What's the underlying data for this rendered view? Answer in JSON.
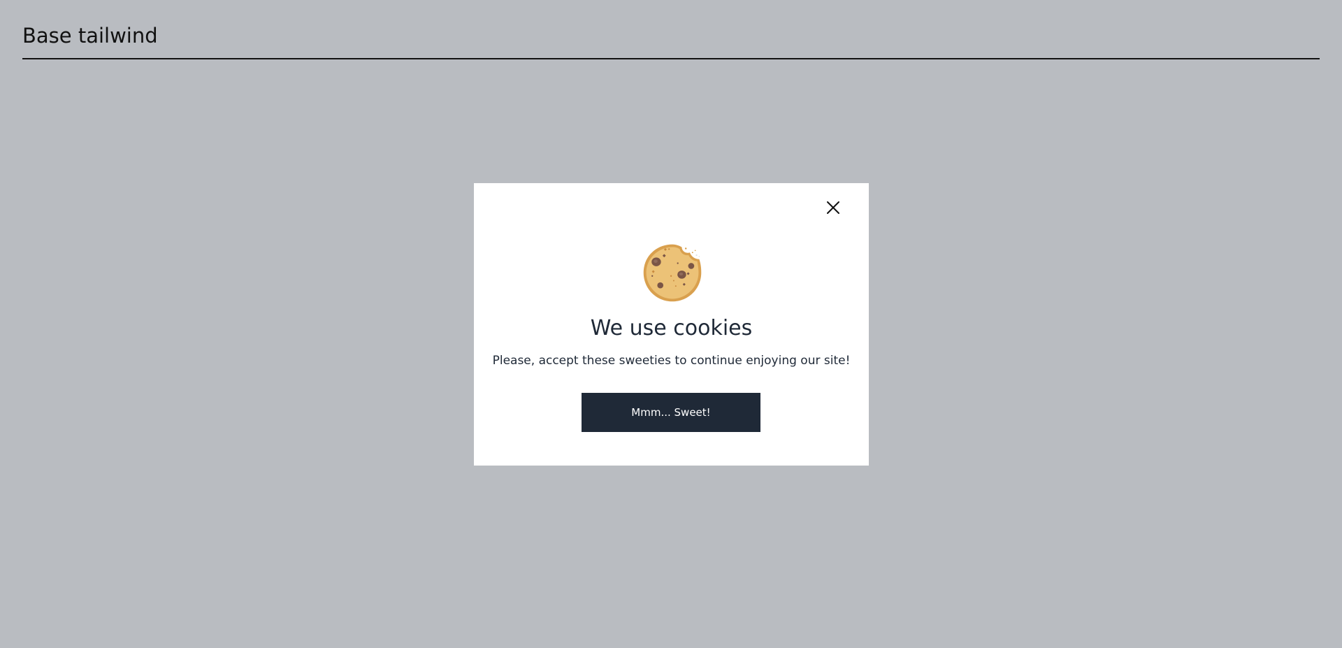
{
  "header": {
    "title": "Base tailwind"
  },
  "modal": {
    "close_icon": "close-icon",
    "illustration": "cookie-icon",
    "title": "We use cookies",
    "message": "Please, accept these sweeties to continue enjoying our site!",
    "accept_label": "Mmm... Sweet!"
  },
  "colors": {
    "backdrop": "#b9bcc1",
    "modal_background": "#ffffff",
    "text_dark": "#1f2937",
    "button_background": "#1f2937",
    "button_text": "#ffffff",
    "cookie_base": "#e9b96b",
    "cookie_edge": "#d9a04e",
    "chocolate_chip": "#7a5546"
  }
}
